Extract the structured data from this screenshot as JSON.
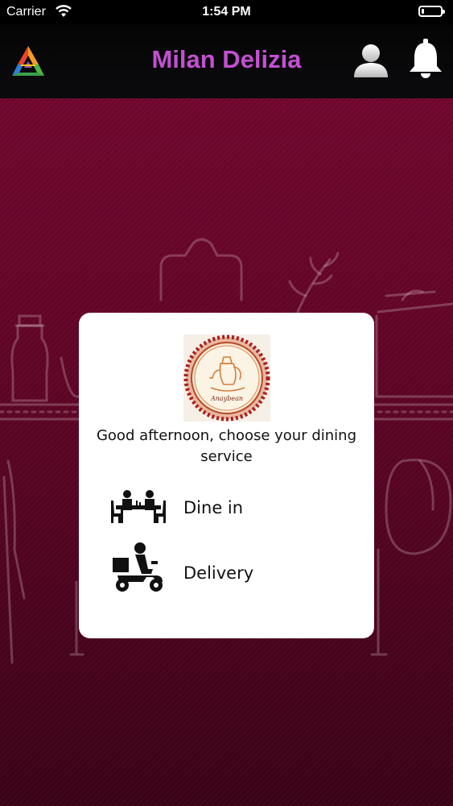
{
  "status_bar": {
    "carrier": "Carrier",
    "time": "1:54 PM",
    "battery_level": 0.15
  },
  "header": {
    "title": "Milan Delizia",
    "title_color": "#c34fd1",
    "left_icon": "app-logo-icon",
    "right_icons": [
      "profile-icon",
      "bell-icon"
    ]
  },
  "card": {
    "brand_logo_name": "Anaybean",
    "greeting": "Good afternoon, choose your dining service",
    "options": [
      {
        "label": "Dine in",
        "icon": "dine-in-icon"
      },
      {
        "label": "Delivery",
        "icon": "delivery-scooter-icon"
      }
    ]
  },
  "colors": {
    "background": "#5b0424",
    "card": "#ffffff",
    "navbar": "#000000"
  }
}
